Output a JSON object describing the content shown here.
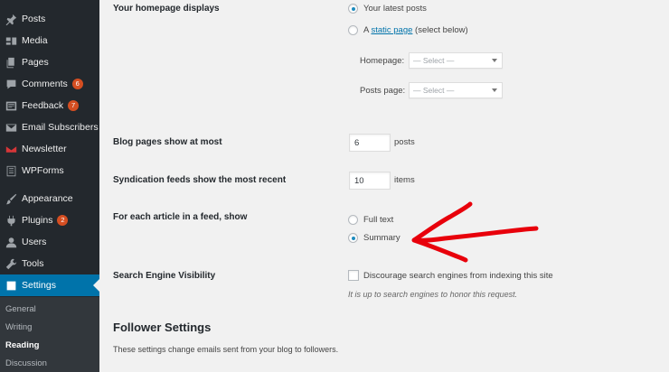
{
  "sidebar": {
    "items": [
      {
        "label": "Posts",
        "icon": "pin-icon"
      },
      {
        "label": "Media",
        "icon": "media-icon"
      },
      {
        "label": "Pages",
        "icon": "pages-icon"
      },
      {
        "label": "Comments",
        "icon": "comments-icon",
        "badge": "6"
      },
      {
        "label": "Feedback",
        "icon": "feedback-icon",
        "badge": "7"
      },
      {
        "label": "Email Subscribers",
        "icon": "email-icon"
      },
      {
        "label": "Newsletter",
        "icon": "newsletter-icon"
      },
      {
        "label": "WPForms",
        "icon": "forms-icon"
      },
      {
        "label": "Appearance",
        "icon": "appearance-icon"
      },
      {
        "label": "Plugins",
        "icon": "plugins-icon",
        "badge": "2"
      },
      {
        "label": "Users",
        "icon": "users-icon"
      },
      {
        "label": "Tools",
        "icon": "tools-icon"
      },
      {
        "label": "Settings",
        "icon": "settings-icon"
      }
    ],
    "submenu": [
      "General",
      "Writing",
      "Reading",
      "Discussion"
    ]
  },
  "homepage": {
    "label": "Your homepage displays",
    "option_latest": "Your latest posts",
    "option_static_prefix": "A",
    "option_static_link": "static page",
    "option_static_suffix": "(select below)",
    "homepage_label": "Homepage:",
    "homepage_value": "— Select —",
    "postspage_label": "Posts page:",
    "postspage_value": "— Select —"
  },
  "blog_pages": {
    "label": "Blog pages show at most",
    "value": "6",
    "unit": "posts"
  },
  "syndication": {
    "label": "Syndication feeds show the most recent",
    "value": "10",
    "unit": "items"
  },
  "feed_article": {
    "label": "For each article in a feed, show",
    "option_full": "Full text",
    "option_summary": "Summary"
  },
  "search_engine": {
    "label": "Search Engine Visibility",
    "checkbox_label": "Discourage search engines from indexing this site",
    "description": "It is up to search engines to honor this request."
  },
  "follower": {
    "heading": "Follower Settings",
    "description": "These settings change emails sent from your blog to followers."
  },
  "colors": {
    "accent": "#0073aa",
    "sidebar_bg": "#23282d",
    "badge": "#d54e21",
    "annotation": "#e8000b"
  }
}
